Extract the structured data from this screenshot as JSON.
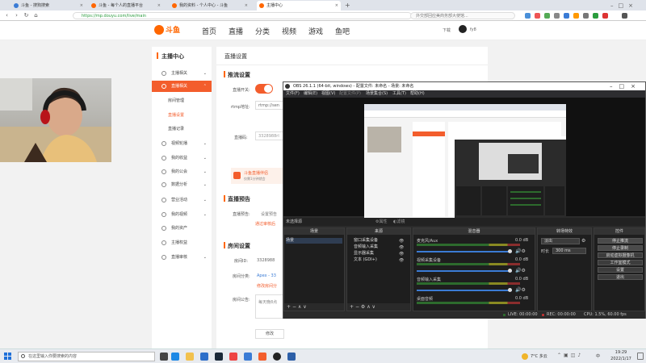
{
  "browser": {
    "tabs": [
      {
        "label": "斗鱼 - 搜狗搜索"
      },
      {
        "label": "斗鱼 - 每个人的直播平台"
      },
      {
        "label": "我的资料 - 个人中心 - 斗鱼"
      },
      {
        "label": "主播中心"
      }
    ],
    "url": "https://mp.douyu.com/live/main",
    "search_placeholder": "外交部回应美商务部大使馆..."
  },
  "douyu": {
    "nav": [
      "首页",
      "直播",
      "分类",
      "视频",
      "游戏",
      "鱼吧"
    ],
    "user": "fy8",
    "download": "下载",
    "sidebar": {
      "title": "主播中心",
      "items": [
        {
          "label": "主播相关"
        },
        {
          "label": "直播相关"
        },
        {
          "label": "房间管理"
        },
        {
          "label": "直播设置"
        },
        {
          "label": "直播记录"
        },
        {
          "label": "视频轮播"
        },
        {
          "label": "我的收益"
        },
        {
          "label": "我的公会"
        },
        {
          "label": "数据分析"
        },
        {
          "label": "营业活动"
        },
        {
          "label": "我的视频"
        },
        {
          "label": "我的资产"
        },
        {
          "label": "主播权益"
        },
        {
          "label": "直播审核"
        }
      ]
    },
    "content": {
      "page_title": "直播设置",
      "section_push": "推流设置",
      "live_switch": "直播开关:",
      "rtmp_label": "rtmp地址:",
      "rtmp_value": "rtmp://sen",
      "stream_label": "直播码:",
      "stream_value": "3328988rl",
      "promo_title": "斗鱼直播伴侣",
      "promo_sub": "仅需1分钟就会",
      "section_report": "直播预告",
      "report_label": "直播预告:",
      "report_value": "设置预告",
      "report_note": "通过审核后",
      "section_room": "房间设置",
      "room_id_label": "房间ID:",
      "room_id": "3328988",
      "room_cat_label": "房间分类:",
      "room_cat": "Apex - 33",
      "room_cat_note": "修改房间分",
      "room_notice_label": "房间公告:",
      "room_notice": "每天晚8点",
      "save_button": "修改"
    }
  },
  "obs": {
    "title": "OBS 26.1.1 (64-bit, windows) - 配置文件: 未命名 - 场景: 未命名",
    "menu": [
      "文件(F)",
      "编辑(E)",
      "视图(V)",
      "配置文件(P)",
      "场景集合(S)",
      "工具(T)",
      "帮助(H)"
    ],
    "source_bar": "未选择源",
    "source_bar_buttons": [
      "属性",
      "滤镜"
    ],
    "docks": {
      "scenes": {
        "title": "场景",
        "items": [
          "场景"
        ]
      },
      "sources": {
        "title": "来源",
        "items": [
          "窗口采集设备",
          "音频输入采集",
          "显示器采集",
          "文本 (GDI+)"
        ]
      },
      "mixer": {
        "title": "混音器",
        "channels": [
          {
            "name": "麦克风/Aux",
            "db": "0.0 dB"
          },
          {
            "name": "视频采集设备",
            "db": "0.0 dB"
          },
          {
            "name": "音频输入采集",
            "db": "0.0 dB"
          },
          {
            "name": "桌面音频",
            "db": "0.0 dB"
          }
        ]
      },
      "transitions": {
        "title": "转场特效",
        "type": "淡出",
        "duration_label": "时长",
        "duration": "300 ms"
      },
      "controls": {
        "title": "控件",
        "buttons": [
          "停止推流",
          "停止录制",
          "启动虚拟摄像机",
          "工作室模式",
          "设置",
          "退出"
        ]
      }
    },
    "status": {
      "live": "LIVE: 00:00:00",
      "rec": "REC: 00:00:00",
      "cpu": "CPU: 1.5%, 60.00 fps"
    }
  },
  "taskbar": {
    "search": "在这里输入你要搜索的内容",
    "weather": "7°C 多云",
    "time": "19:29",
    "date": "2022/1/17",
    "lang": "中"
  },
  "colors": {
    "accent": "#f35d2c",
    "obs_bg": "#2b2b2b",
    "meter_green": "#2d6b2d"
  }
}
